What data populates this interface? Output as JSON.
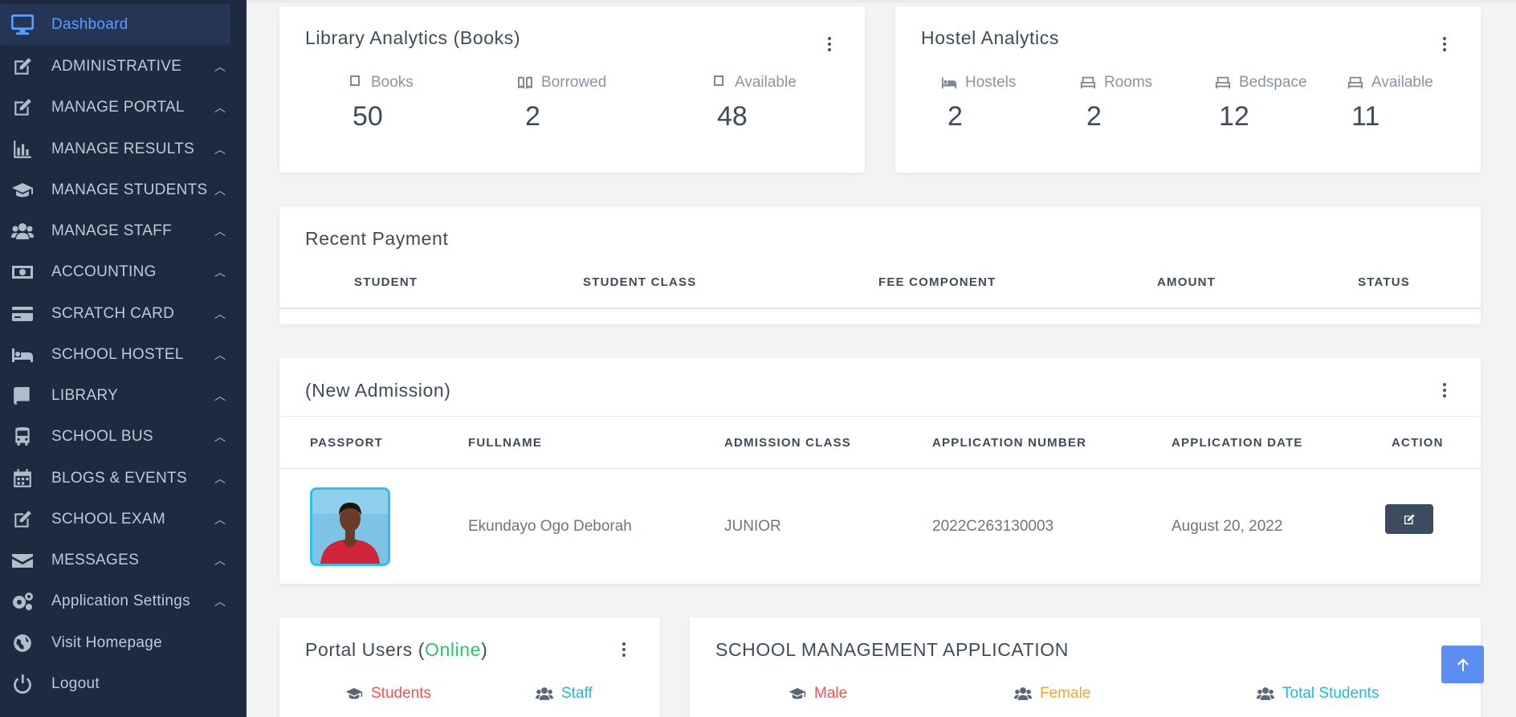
{
  "sidebar": {
    "items": [
      {
        "label": "Dashboard",
        "icon": "monitor-icon",
        "active": true
      },
      {
        "label": "ADMINISTRATIVE",
        "icon": "edit-icon"
      },
      {
        "label": "MANAGE PORTAL",
        "icon": "edit-icon"
      },
      {
        "label": "MANAGE RESULTS",
        "icon": "bar-chart-icon"
      },
      {
        "label": "MANAGE STUDENTS",
        "icon": "graduation-cap-icon"
      },
      {
        "label": "MANAGE STAFF",
        "icon": "users-icon"
      },
      {
        "label": "ACCOUNTING",
        "icon": "money-icon"
      },
      {
        "label": "SCRATCH CARD",
        "icon": "credit-card-icon"
      },
      {
        "label": "SCHOOL HOSTEL",
        "icon": "bed-icon"
      },
      {
        "label": "LIBRARY",
        "icon": "book-icon"
      },
      {
        "label": "SCHOOL BUS",
        "icon": "bus-icon"
      },
      {
        "label": "BLOGS & EVENTS",
        "icon": "calendar-icon"
      },
      {
        "label": "SCHOOL EXAM",
        "icon": "edit-icon"
      },
      {
        "label": "MESSAGES",
        "icon": "envelope-icon"
      },
      {
        "label": "Application Settings",
        "icon": "gears-icon"
      },
      {
        "label": "Visit Homepage",
        "icon": "globe-icon"
      },
      {
        "label": "Logout",
        "icon": "power-icon"
      }
    ]
  },
  "library": {
    "title": "Library Analytics (Books)",
    "stats": [
      {
        "label": "Books",
        "value": "50",
        "icon": "book-icon"
      },
      {
        "label": "Borrowed",
        "value": "2",
        "icon": "open-book-icon"
      },
      {
        "label": "Available",
        "value": "48",
        "icon": "book-icon"
      }
    ]
  },
  "hostel": {
    "title": "Hostel Analytics",
    "stats": [
      {
        "label": "Hostels",
        "value": "2",
        "icon": "bed-icon"
      },
      {
        "label": "Rooms",
        "value": "2",
        "icon": "bed-frame-icon"
      },
      {
        "label": "Bedspace",
        "value": "12",
        "icon": "bed-frame-icon"
      },
      {
        "label": "Available",
        "value": "11",
        "icon": "bed-frame-icon"
      }
    ]
  },
  "payments": {
    "title": "Recent Payment",
    "columns": [
      "STUDENT",
      "STUDENT CLASS",
      "FEE COMPONENT",
      "AMOUNT",
      "STATUS"
    ]
  },
  "admission": {
    "title": "(New Admission)",
    "columns": [
      "PASSPORT",
      "FULLNAME",
      "ADMISSION CLASS",
      "APPLICATION NUMBER",
      "APPLICATION DATE",
      "ACTION"
    ],
    "rows": [
      {
        "fullname": "Ekundayo Ogo Deborah",
        "class": "JUNIOR",
        "number": "2022C263130003",
        "date": "August 20, 2022"
      }
    ]
  },
  "portal_users": {
    "title_prefix": "Portal Users (",
    "title_online": "Online",
    "title_suffix": ")",
    "legend": [
      {
        "label": "Students",
        "color": "#f05252",
        "icon": "graduation-cap-icon"
      },
      {
        "label": "Staff",
        "color": "#22b9d6",
        "icon": "users-icon"
      }
    ]
  },
  "school_app": {
    "title": "SCHOOL MANAGEMENT APPLICATION",
    "legend": [
      {
        "label": "Male",
        "color": "#f05252",
        "icon": "graduation-cap-icon"
      },
      {
        "label": "Female",
        "color": "#f5a623",
        "icon": "users-icon"
      },
      {
        "label": "Total Students",
        "color": "#22b9d6",
        "icon": "users-icon"
      }
    ]
  },
  "colors": {
    "online": "#2dc26b",
    "accent": "#5b8ef0",
    "sidebar_bg": "#1e2a40"
  }
}
